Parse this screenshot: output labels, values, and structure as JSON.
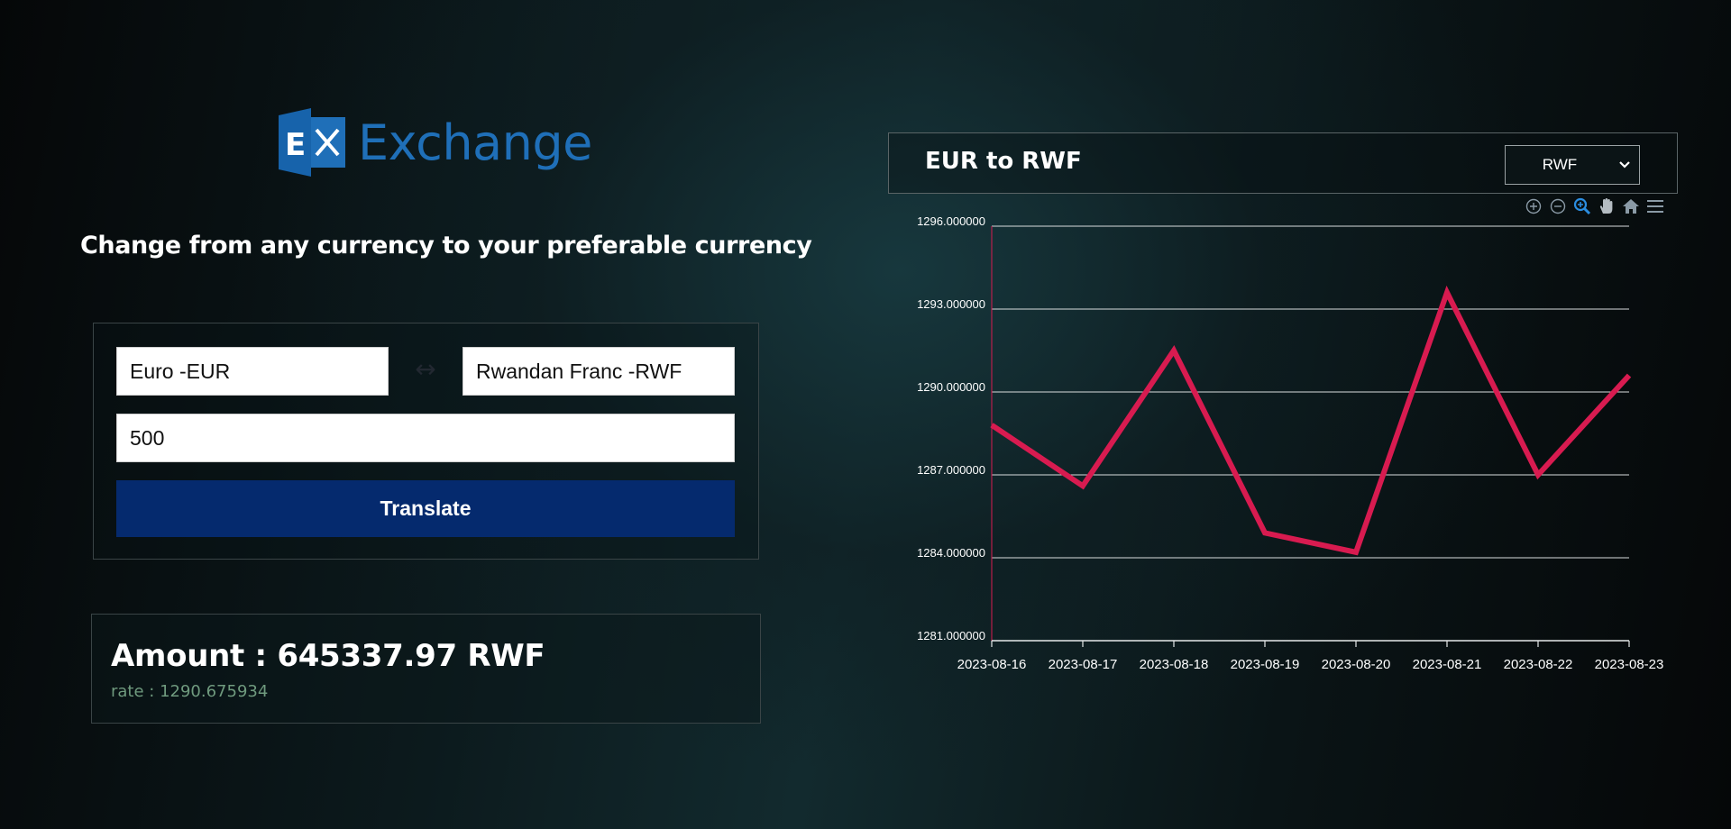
{
  "app": {
    "logo_text": "Exchange",
    "subtitle": "Change from any currency to your preferable currency"
  },
  "form": {
    "from_currency": "Euro -EUR",
    "to_currency": "Rwandan Franc -RWF",
    "swap_symbol": "↔",
    "amount": "500",
    "translate_label": "Translate"
  },
  "result": {
    "amount_text": "Amount : 645337.97 RWF",
    "rate_text": "rate : 1290.675934"
  },
  "chart_header": {
    "title": "EUR to RWF",
    "selected_currency": "RWF"
  },
  "toolbar": {
    "icons": [
      "zoom-in-icon",
      "zoom-out-icon",
      "zoom-select-icon",
      "pan-hand-icon",
      "home-reset-icon",
      "menu-icon"
    ]
  },
  "colors": {
    "logo_blue": "#1f6fb8",
    "button_navy": "#052a6e",
    "line_red": "#d81b50",
    "rate_green": "#6f9a7e"
  },
  "chart_data": {
    "type": "line",
    "x": [
      "2023-08-16",
      "2023-08-17",
      "2023-08-18",
      "2023-08-19",
      "2023-08-20",
      "2023-08-21",
      "2023-08-22",
      "2023-08-23"
    ],
    "series": [
      {
        "values": [
          1288.8,
          1286.6,
          1291.5,
          1284.9,
          1284.2,
          1293.6,
          1287.0,
          1290.6
        ]
      }
    ],
    "yticks": [
      "1281.000000",
      "1284.000000",
      "1287.000000",
      "1290.000000",
      "1293.000000",
      "1296.000000"
    ],
    "ylim": [
      1281,
      1296
    ],
    "grid": true,
    "legend": "none"
  }
}
